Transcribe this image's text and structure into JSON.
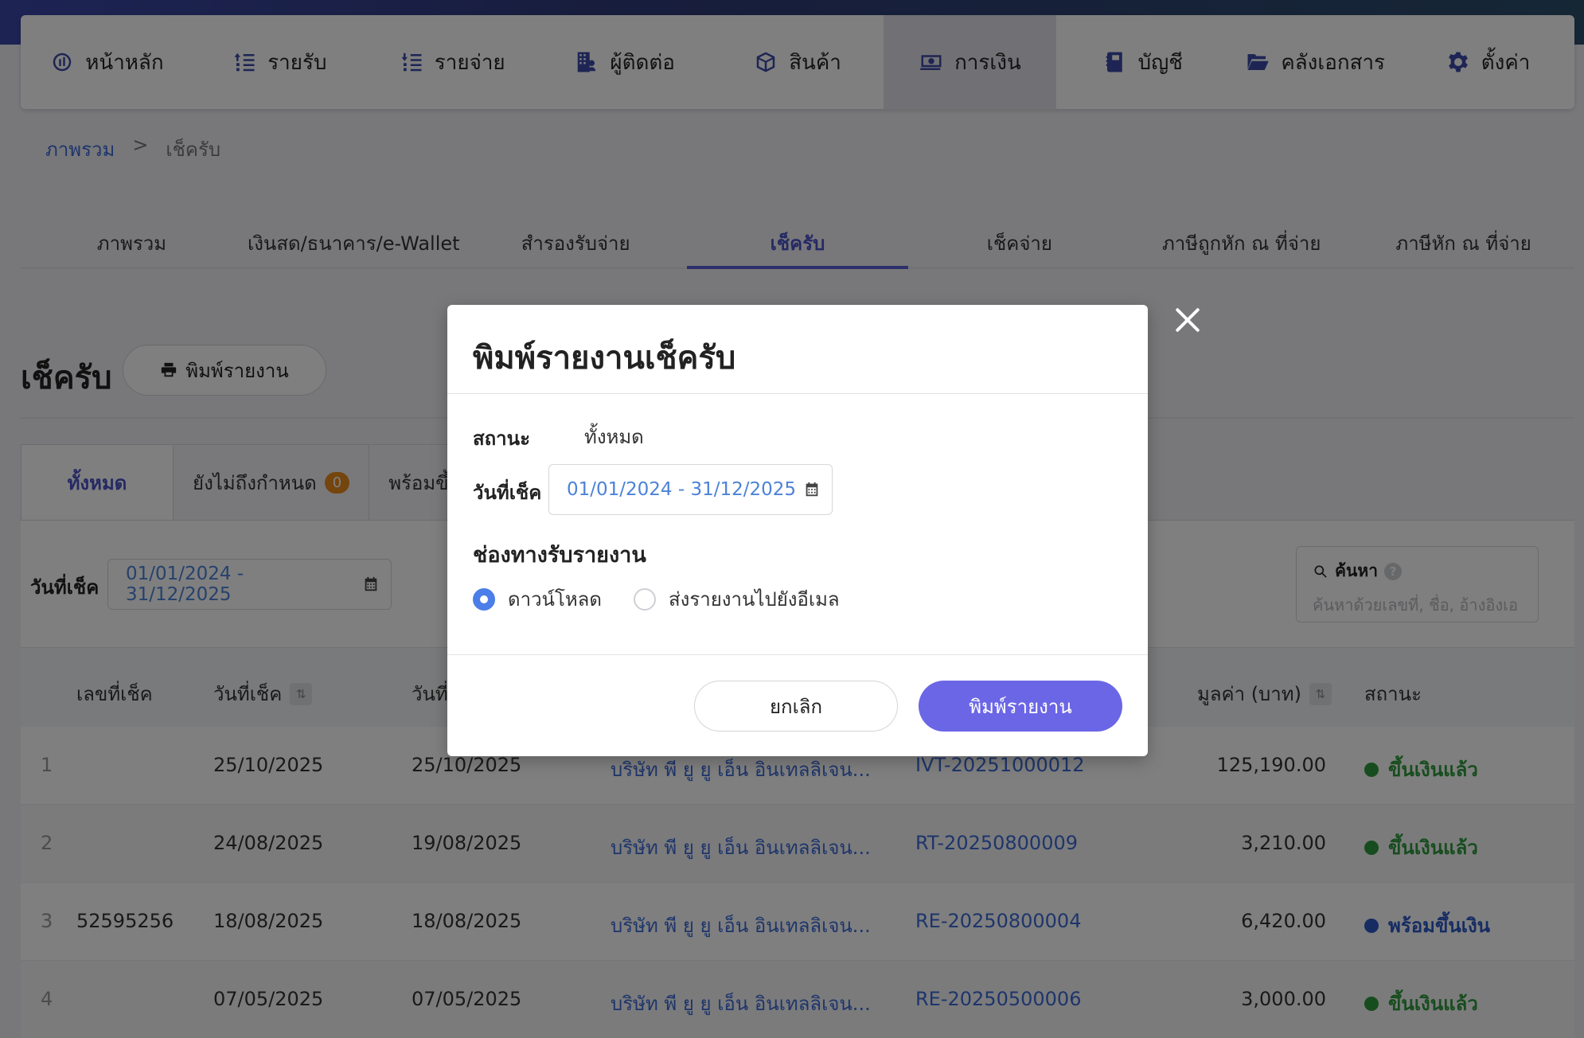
{
  "nav": [
    {
      "label": "หน้าหลัก",
      "icon": "dashboard-icon"
    },
    {
      "label": "รายรับ",
      "icon": "income-list-icon"
    },
    {
      "label": "รายจ่าย",
      "icon": "expense-list-icon"
    },
    {
      "label": "ผู้ติดต่อ",
      "icon": "contacts-building-icon"
    },
    {
      "label": "สินค้า",
      "icon": "product-box-icon"
    },
    {
      "label": "การเงิน",
      "icon": "money-icon",
      "active": true
    },
    {
      "label": "บัญชี",
      "icon": "ledger-book-icon"
    },
    {
      "label": "คลังเอกสาร",
      "icon": "folder-icon"
    },
    {
      "label": "ตั้งค่า",
      "icon": "gear-icon"
    }
  ],
  "breadcrumb": {
    "parent": "ภาพรวม",
    "separator": ">",
    "current": "เช็ครับ"
  },
  "subtabs": [
    "ภาพรวม",
    "เงินสด/ธนาคาร/e-Wallet",
    "สำรองรับจ่าย",
    "เช็ครับ",
    "เช็คจ่าย",
    "ภาษีถูกหัก ณ ที่จ่าย",
    "ภาษีหัก ณ ที่จ่าย"
  ],
  "page": {
    "title": "เช็ครับ",
    "print_button": "พิมพ์รายงาน"
  },
  "status_tabs": {
    "all": "ทั้งหมด",
    "not_due": "ยังไม่ถึงกำหนด",
    "not_due_count": "0",
    "ready": "พร้อมขึ้"
  },
  "filter": {
    "date_label": "วันที่เช็ค",
    "date_range": "01/01/2024 - 31/12/2025"
  },
  "search": {
    "label": "ค้นหา",
    "help": "?",
    "placeholder": "ค้นหาด้วยเลขที่, ชื่อ, อ้างอิงเอ"
  },
  "table": {
    "headers": {
      "cheque_no": "เลขที่เช็ค",
      "cheque_date": "วันที่เช็ค",
      "doc_date": "วันที่",
      "amount": "มูลค่า (บาท)",
      "status": "สถานะ"
    },
    "rows": [
      {
        "idx": "1",
        "cheque_no": "",
        "cheque_date": "25/10/2025",
        "doc_date": "25/10/2025",
        "company": "บริษัท พี ยู ยู เอ็น อินเทลลิเจน...",
        "ref": "IVT-20251000012",
        "amount": "125,190.00",
        "status": "ขึ้นเงินแล้ว",
        "status_color": "#2e9a3c"
      },
      {
        "idx": "2",
        "cheque_no": "",
        "cheque_date": "24/08/2025",
        "doc_date": "19/08/2025",
        "company": "บริษัท พี ยู ยู เอ็น อินเทลลิเจน...",
        "ref": "RT-20250800009",
        "amount": "3,210.00",
        "status": "ขึ้นเงินแล้ว",
        "status_color": "#2e9a3c"
      },
      {
        "idx": "3",
        "cheque_no": "52595256",
        "cheque_date": "18/08/2025",
        "doc_date": "18/08/2025",
        "company": "บริษัท พี ยู ยู เอ็น อินเทลลิเจน...",
        "ref": "RE-20250800004",
        "amount": "6,420.00",
        "status": "พร้อมขึ้นเงิน",
        "status_color": "#2c59c6"
      },
      {
        "idx": "4",
        "cheque_no": "",
        "cheque_date": "07/05/2025",
        "doc_date": "07/05/2025",
        "company": "บริษัท พี ยู ยู เอ็น อินเทลลิเจน...",
        "ref": "RE-20250500006",
        "amount": "3,000.00",
        "status": "ขึ้นเงินแล้ว",
        "status_color": "#2e9a3c"
      }
    ]
  },
  "modal": {
    "title": "พิมพ์รายงานเช็ครับ",
    "status_label": "สถานะ",
    "status_value": "ทั้งหมด",
    "date_label": "วันที่เช็ค",
    "date_range": "01/01/2024 - 31/12/2025",
    "channel_label": "ช่องทางรับรายงาน",
    "option_download": "ดาวน์โหลด",
    "option_email": "ส่งรายงานไปยังอีเมล",
    "cancel": "ยกเลิก",
    "print": "พิมพ์รายงาน"
  },
  "colors": {
    "accent": "#6b66e6",
    "brand": "#3d4aa8",
    "link": "#3d6ad6",
    "success": "#2e9a3c",
    "info": "#2c59c6",
    "badge": "#e88a1a"
  }
}
